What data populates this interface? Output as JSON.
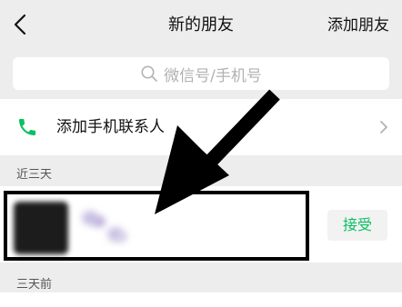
{
  "header": {
    "title": "新的朋友",
    "add_friend_label": "添加朋友"
  },
  "search": {
    "placeholder": "微信号/手机号"
  },
  "phone_contacts": {
    "label": "添加手机联系人"
  },
  "sections": {
    "recent": "近三天",
    "before": "三天前"
  },
  "request": {
    "accept_label": "接受"
  },
  "colors": {
    "accent_green": "#07c160",
    "background": "#ededed"
  },
  "icons": {
    "back": "chevron-left-icon",
    "search": "search-icon",
    "phone": "phone-icon",
    "chevron_right": "chevron-right-icon"
  }
}
